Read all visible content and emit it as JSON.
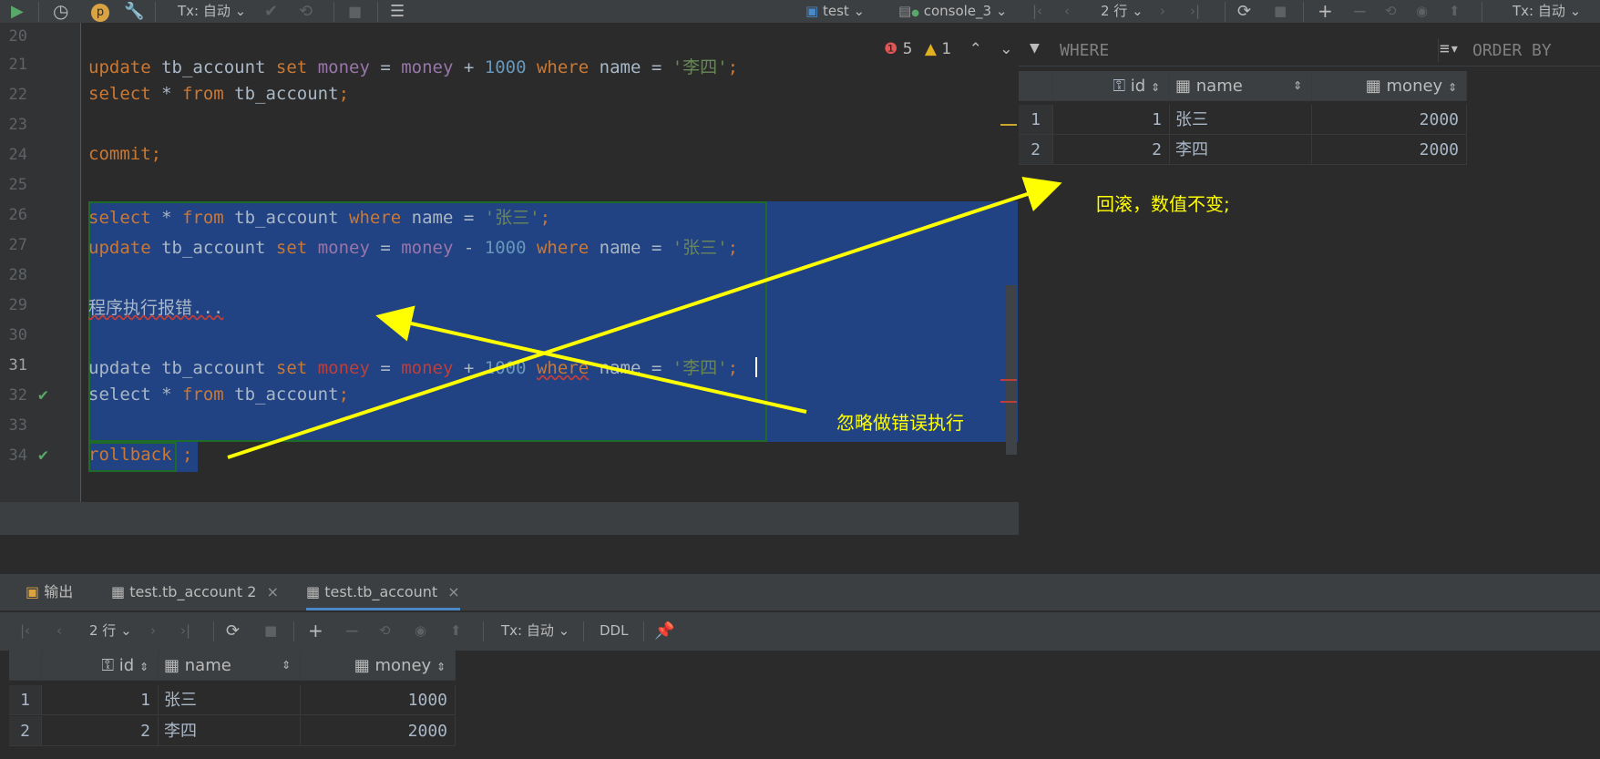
{
  "toolbar": {
    "run_icon": "play-icon",
    "tx_mode": "Tx: 自动",
    "datasource": "test",
    "console": "console_3"
  },
  "result_toolbar": {
    "row_count": "2 行",
    "tx_mode": "Tx: 自动"
  },
  "editor": {
    "line_numbers": [
      "20",
      "21",
      "22",
      "23",
      "24",
      "25",
      "26",
      "27",
      "28",
      "29",
      "30",
      "31",
      "32",
      "33",
      "34"
    ],
    "inspections": {
      "errors": "5",
      "warnings": "1"
    },
    "lines": {
      "l21": {
        "a": "update",
        "b": " tb_account ",
        "c": "set",
        "d": " ",
        "e": "money",
        "f": " = ",
        "g": "money",
        "h": " + ",
        "i": "1000",
        "j": " ",
        "k": "where",
        "l": " name = ",
        "m": "'李四'",
        "n": ";"
      },
      "l22": {
        "a": "select",
        "b": " * ",
        "c": "from",
        "d": " tb_account",
        "e": ";"
      },
      "l24": {
        "a": "commit",
        "b": ";"
      },
      "l26": {
        "a": "select",
        "b": " * ",
        "c": "from",
        "d": " tb_account ",
        "e": "where",
        "f": " name = ",
        "g": "'张三'",
        "h": ";"
      },
      "l27": {
        "a": "update",
        "b": " tb_account ",
        "c": "set",
        "d": " ",
        "e": "money",
        "f": " = ",
        "g": "money",
        "h": " - ",
        "i": "1000",
        "j": " ",
        "k": "where",
        "l": " name = ",
        "m": "'张三'",
        "n": ";"
      },
      "l29": {
        "a": "程序执行报错..."
      },
      "l31": {
        "a": "update",
        "b": " tb_account ",
        "c": "set",
        "d": " ",
        "e": "money",
        "f": " = ",
        "g": "money",
        "h": " + ",
        "i": "1000",
        "j": " ",
        "k": "where",
        "l": " name = ",
        "m": "'李四'",
        "n": ";"
      },
      "l32": {
        "a": "select",
        "b": " * ",
        "c": "from",
        "d": " tb_account",
        "e": ";"
      },
      "l34": {
        "a": "rollback",
        "b": " ;"
      }
    }
  },
  "right_result": {
    "filter_placeholder": "WHERE",
    "order_placeholder": "ORDER BY",
    "columns": [
      "id",
      "name",
      "money"
    ],
    "rows": [
      {
        "no": "1",
        "id": "1",
        "name": "张三",
        "money": "2000"
      },
      {
        "no": "2",
        "id": "2",
        "name": "李四",
        "money": "2000"
      }
    ]
  },
  "annotations": {
    "rollback_note": "回滚，数值不变;",
    "ignore_note": "忽略做错误执行",
    "arrow_color": "#ffff00"
  },
  "bottom": {
    "tabs": [
      "输出",
      "test.tb_account 2",
      "test.tb_account"
    ],
    "row_count": "2 行",
    "tx_mode": "Tx: 自动",
    "ddl": "DDL",
    "columns": [
      "id",
      "name",
      "money"
    ],
    "rows": [
      {
        "no": "1",
        "id": "1",
        "name": "张三",
        "money": "1000"
      },
      {
        "no": "2",
        "id": "2",
        "name": "李四",
        "money": "2000"
      }
    ]
  }
}
